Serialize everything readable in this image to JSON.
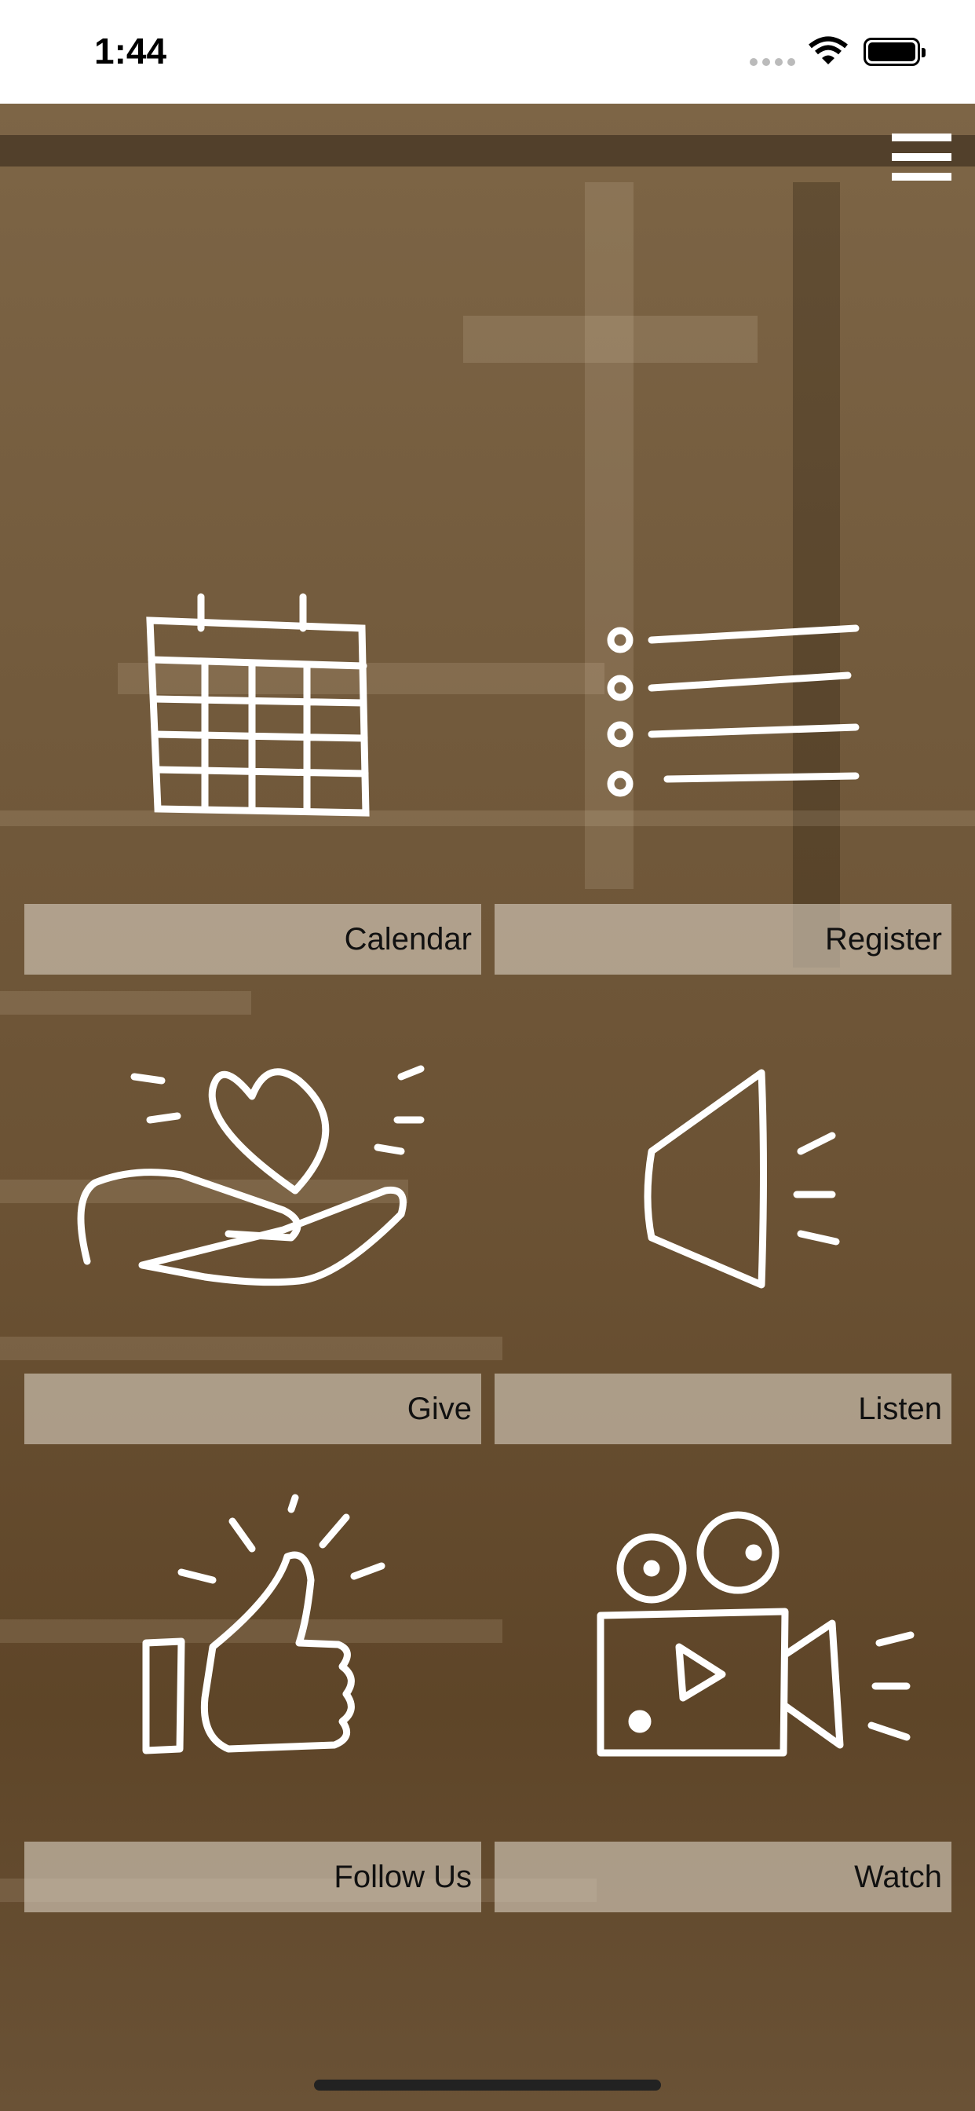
{
  "status_bar": {
    "time": "1:44"
  },
  "header": {
    "menu_icon": "hamburger-menu-icon"
  },
  "tiles": [
    {
      "label": "Calendar",
      "icon": "calendar-icon"
    },
    {
      "label": "Register",
      "icon": "list-icon"
    },
    {
      "label": "Give",
      "icon": "heart-hand-icon"
    },
    {
      "label": "Listen",
      "icon": "speaker-icon"
    },
    {
      "label": "Follow Us",
      "icon": "thumbs-up-icon"
    },
    {
      "label": "Watch",
      "icon": "video-camera-icon"
    }
  ],
  "colors": {
    "background": "#725a3c",
    "label_bg": "#d2c8b9",
    "icon": "#ffffff"
  }
}
